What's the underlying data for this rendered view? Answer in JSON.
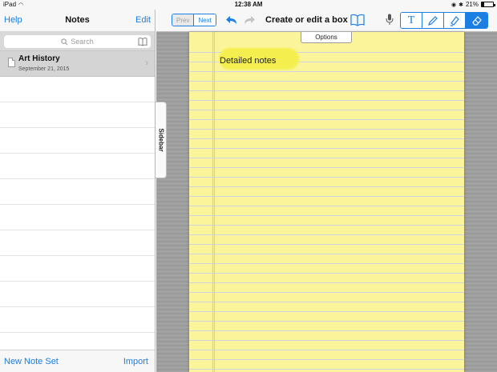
{
  "status": {
    "device": "iPad",
    "time": "12:38 AM",
    "battery": "21%",
    "battery_level": 0.21
  },
  "left_pane": {
    "help_label": "Help",
    "title": "Notes",
    "edit_label": "Edit",
    "search_placeholder": "Search",
    "notes": [
      {
        "title": "Art History",
        "date": "September 21, 2015"
      }
    ],
    "new_note_set_label": "New Note Set",
    "import_label": "Import"
  },
  "sidebar_tab": {
    "label": "Sidebar"
  },
  "toolbar": {
    "prev_label": "Prev",
    "next_label": "Next",
    "title": "Create or edit a box",
    "text_tool_label": "T",
    "active_tool": "eraser"
  },
  "document": {
    "options_label": "Options",
    "body_text": "Detailed notes",
    "paper_color": "#fbf49a",
    "highlight_color": "#f4ef4e"
  },
  "colors": {
    "accent": "#1a7ee2"
  }
}
